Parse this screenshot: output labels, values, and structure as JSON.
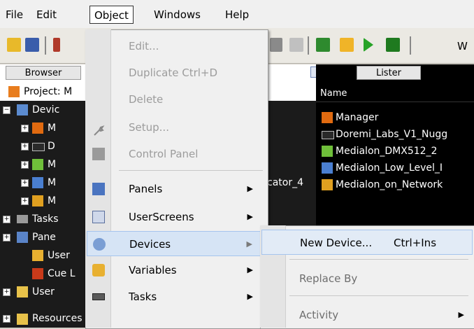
{
  "menubar": {
    "file": "File",
    "edit": "Edit",
    "object": "Object",
    "windows": "Windows",
    "help": "Help"
  },
  "toolbar": {
    "trailing_text": "W"
  },
  "browser": {
    "tab_label": "Browser",
    "tree": [
      {
        "label": "Project: M"
      },
      {
        "label": "Devic"
      },
      {
        "label": "M"
      },
      {
        "label": "D"
      },
      {
        "label": "M"
      },
      {
        "label": "M"
      },
      {
        "label": "M"
      },
      {
        "label": "Tasks"
      },
      {
        "label": "Pane"
      },
      {
        "label": "User"
      },
      {
        "label": "Cue L"
      },
      {
        "label": "User"
      },
      {
        "label": "Resources"
      }
    ],
    "peek_text": "cator_4"
  },
  "lister": {
    "tab_label": "Lister",
    "column_name": "Name",
    "rows": [
      {
        "label": "Manager"
      },
      {
        "label": "Doremi_Labs_V1_Nugg"
      },
      {
        "label": "Medialon_DMX512_2"
      },
      {
        "label": "Medialon_Low_Level_I"
      },
      {
        "label": "Medialon_on_Network"
      }
    ]
  },
  "object_menu": {
    "items": [
      {
        "label": "Edit...",
        "enabled": false
      },
      {
        "label": "Duplicate Ctrl+D",
        "enabled": false
      },
      {
        "label": "Delete",
        "enabled": false
      },
      {
        "label": "Setup...",
        "enabled": false
      },
      {
        "label": "Control Panel",
        "enabled": false
      },
      {
        "label": "Panels",
        "has_submenu": true
      },
      {
        "label": "UserScreens",
        "has_submenu": true
      },
      {
        "label": "Devices",
        "has_submenu": true,
        "highlighted": true
      },
      {
        "label": "Variables",
        "has_submenu": true
      },
      {
        "label": "Tasks",
        "has_submenu": true
      }
    ]
  },
  "devices_submenu": {
    "items": [
      {
        "label": "New Device...",
        "shortcut": "Ctrl+Ins",
        "highlighted": true
      },
      {
        "label": "Replace By",
        "enabled": false
      },
      {
        "label": "Activity",
        "has_submenu": true
      }
    ]
  },
  "colors": {
    "highlight": "#d6e4f5",
    "highlight_border": "#a5c4ee",
    "lister_bg": "#000000"
  }
}
